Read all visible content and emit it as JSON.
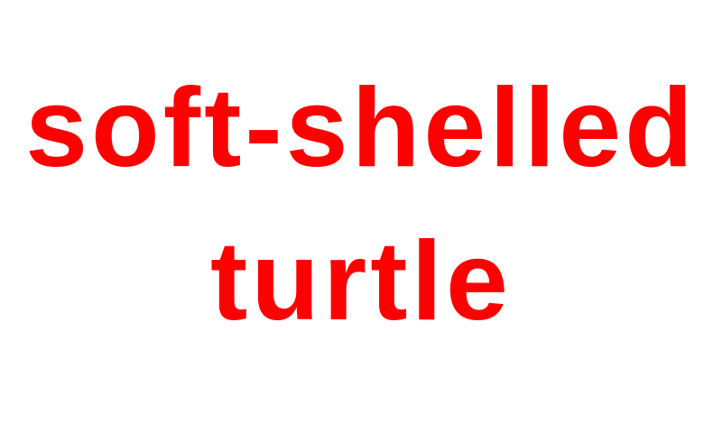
{
  "label": {
    "lines": [
      "soft-shelled",
      "turtle"
    ],
    "color": "#ff0000"
  },
  "background_color": "#ffffff"
}
